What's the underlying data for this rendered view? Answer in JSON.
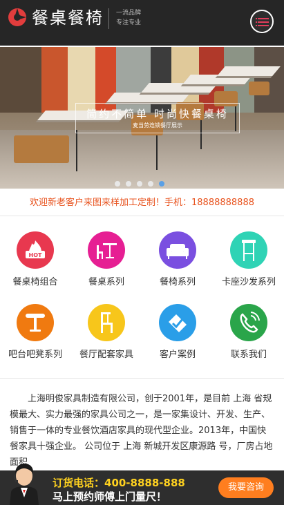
{
  "header": {
    "logo_text": "餐桌餐椅",
    "tagline_1": "一流品牌",
    "tagline_2": "专注专业",
    "menu_icon": "menu-list-icon"
  },
  "banner": {
    "title": "简约不简单 时尚快餐桌椅",
    "subtitle": "麦当劳连锁餐厅展示",
    "slide_count": 5,
    "active_slide": 5
  },
  "notice": "欢迎新老客户来图来样加工定制！手机：18888888888",
  "categories": [
    {
      "label": "餐桌椅组合",
      "icon": "hot-icon",
      "color": "#e8384f"
    },
    {
      "label": "餐桌系列",
      "icon": "table-chair-icon",
      "color": "#e61f93"
    },
    {
      "label": "餐椅系列",
      "icon": "sofa-icon",
      "color": "#7a4fe0"
    },
    {
      "label": "卡座沙发系列",
      "icon": "bar-stool-icon",
      "color": "#2fd3b5"
    },
    {
      "label": "吧台吧凳系列",
      "icon": "round-table-icon",
      "color": "#f07a10"
    },
    {
      "label": "餐厅配套家具",
      "icon": "chair-icon",
      "color": "#f7c61b"
    },
    {
      "label": "客户案例",
      "icon": "cases-icon",
      "color": "#2a9ee8"
    },
    {
      "label": "联系我们",
      "icon": "phone-icon",
      "color": "#2aa54a"
    }
  ],
  "intro": "上海明俊家具制造有限公司，创于2001年，是目前 上海 省规模最大、实力最强的家具公司之一，是一家集设计、开发、生产、销售于一体的专业餐饮酒店家具的现代型企业。2013年，中国快餐家具十强企业。 公司位于 上海 新城开发区康源路 号，厂房占地面积",
  "bottom_bar": {
    "hotline": "订货电话：400-8888-888",
    "promo": "马上预约师傅上门量尺！",
    "consult_button": "我要咨询"
  }
}
